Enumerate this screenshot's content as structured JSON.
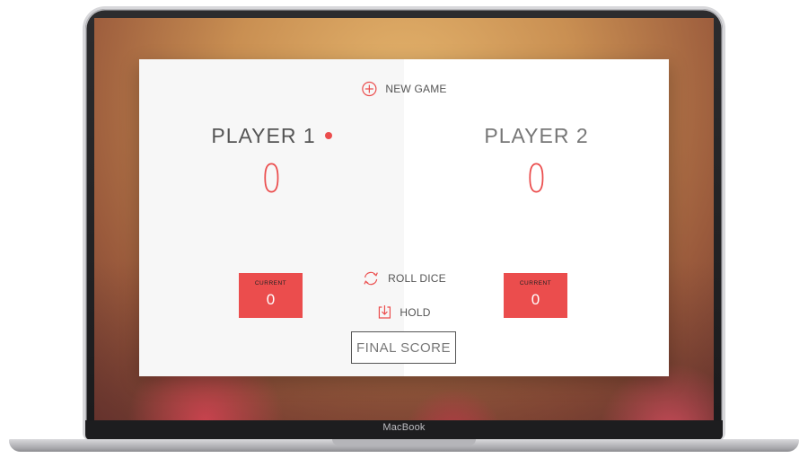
{
  "device": {
    "brand_label": "MacBook"
  },
  "game": {
    "new_game_label": "NEW GAME",
    "roll_dice_label": "ROLL DICE",
    "hold_label": "HOLD",
    "final_score_placeholder": "FINAL SCORE",
    "active_player": 1,
    "players": [
      {
        "name": "PLAYER 1",
        "score": "0",
        "current_label": "CURRENT",
        "current_score": "0"
      },
      {
        "name": "PLAYER 2",
        "score": "0",
        "current_label": "CURRENT",
        "current_score": "0"
      }
    ]
  },
  "colors": {
    "accent": "#eb4d4d",
    "panel_left": "#f7f7f7",
    "panel_right": "#ffffff",
    "text": "#555555"
  },
  "icons": {
    "new_game": "plus-circle-icon",
    "roll_dice": "refresh-icon",
    "hold": "download-box-icon"
  }
}
